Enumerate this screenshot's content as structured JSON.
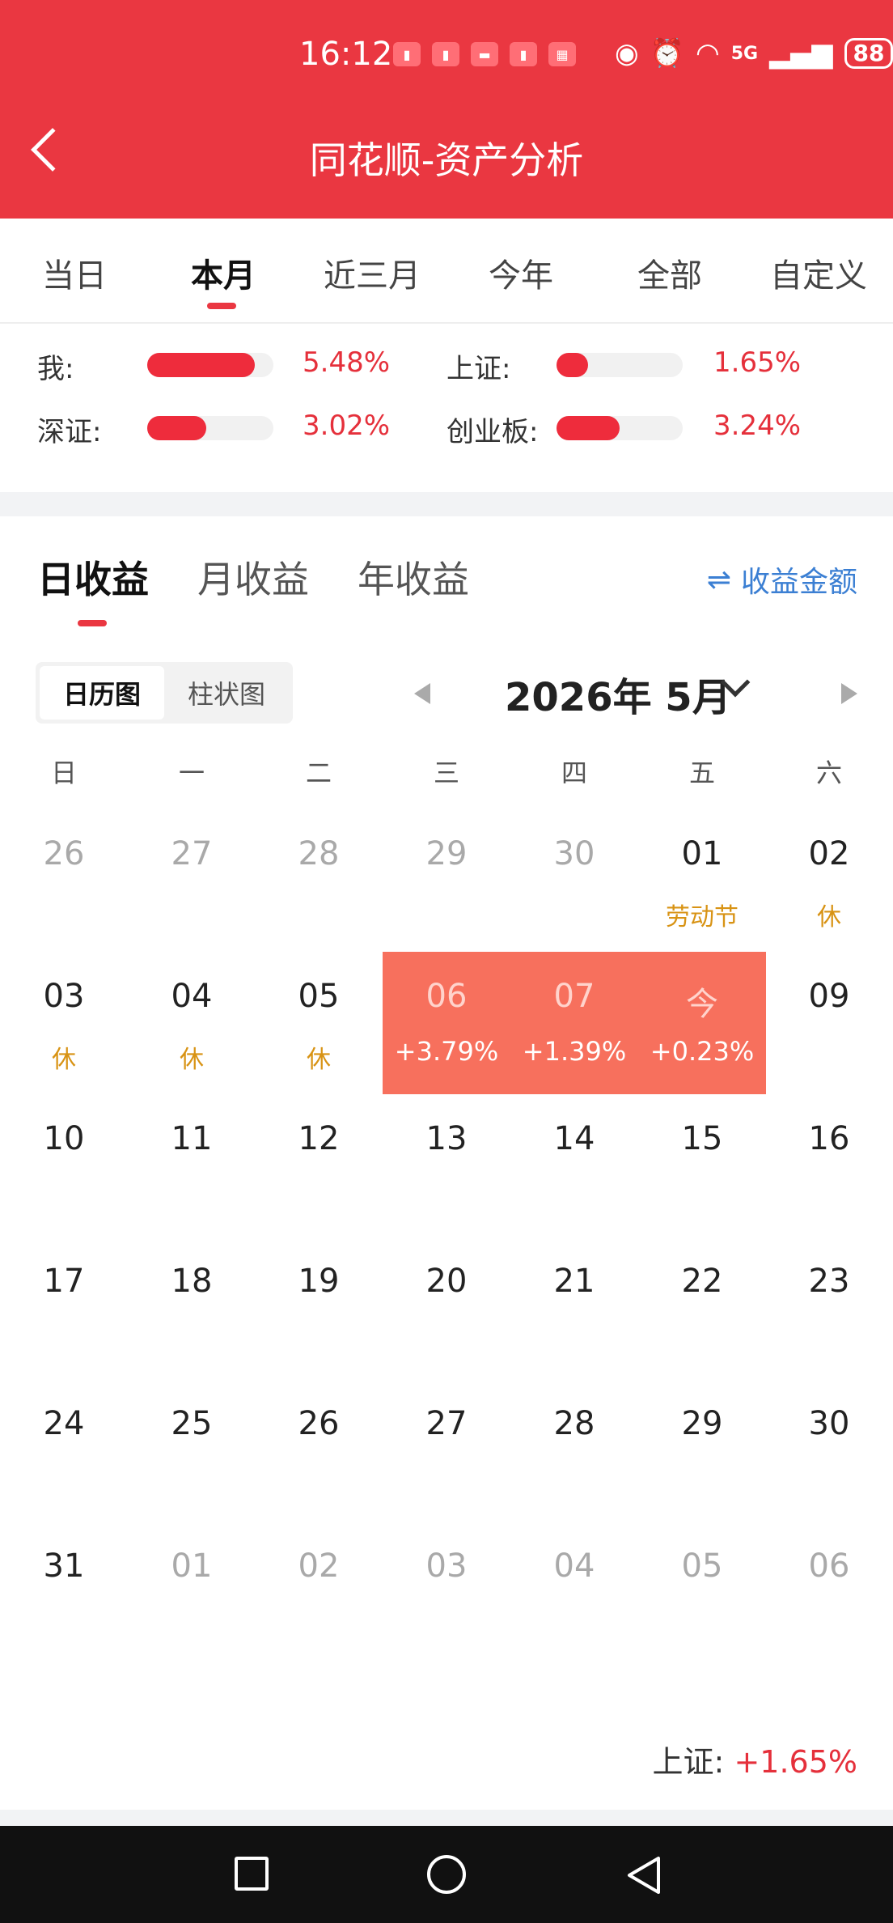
{
  "status_bar": {
    "time": "16:12",
    "notifications": [
      "app-notification-icon",
      "app-notification-icon",
      "huawei-store-icon",
      "app-notification-icon",
      "app-notification-icon"
    ],
    "network": "5G",
    "battery": "88"
  },
  "header": {
    "title": "同花顺-资产分析"
  },
  "period_tabs": [
    {
      "label": "当日"
    },
    {
      "label": "本月",
      "active": true
    },
    {
      "label": "近三月"
    },
    {
      "label": "今年"
    },
    {
      "label": "全部"
    },
    {
      "label": "自定义"
    }
  ],
  "comparison": [
    {
      "label": "我:",
      "value": "5.48%",
      "fill": 0.85
    },
    {
      "label": "上证:",
      "value": "1.65%",
      "fill": 0.25
    },
    {
      "label": "深证:",
      "value": "3.02%",
      "fill": 0.47
    },
    {
      "label": "创业板:",
      "value": "3.24%",
      "fill": 0.5
    }
  ],
  "earnings_tabs": [
    {
      "label": "日收益",
      "active": true
    },
    {
      "label": "月收益"
    },
    {
      "label": "年收益"
    }
  ],
  "amount_toggle": {
    "icon": "swap-icon",
    "label": "收益金额"
  },
  "view_switch": [
    {
      "label": "日历图",
      "active": true
    },
    {
      "label": "柱状图"
    }
  ],
  "month_nav": {
    "label": "2026年 5月"
  },
  "weekdays": [
    "日",
    "一",
    "二",
    "三",
    "四",
    "五",
    "六"
  ],
  "calendar": [
    [
      {
        "d": "26",
        "dim": true
      },
      {
        "d": "27",
        "dim": true
      },
      {
        "d": "28",
        "dim": true
      },
      {
        "d": "29",
        "dim": true
      },
      {
        "d": "30",
        "dim": true
      },
      {
        "d": "01",
        "sub": "劳动节"
      },
      {
        "d": "02",
        "sub": "休"
      }
    ],
    [
      {
        "d": "03",
        "sub": "休"
      },
      {
        "d": "04",
        "sub": "休"
      },
      {
        "d": "05",
        "sub": "休"
      },
      {
        "d": "06",
        "sub": "+3.79%",
        "gain": true
      },
      {
        "d": "07",
        "sub": "+1.39%",
        "gain": true
      },
      {
        "d": "今",
        "sub": "+0.23%",
        "gain": true,
        "today": true
      },
      {
        "d": "09"
      }
    ],
    [
      {
        "d": "10"
      },
      {
        "d": "11"
      },
      {
        "d": "12"
      },
      {
        "d": "13"
      },
      {
        "d": "14"
      },
      {
        "d": "15"
      },
      {
        "d": "16"
      }
    ],
    [
      {
        "d": "17"
      },
      {
        "d": "18"
      },
      {
        "d": "19"
      },
      {
        "d": "20"
      },
      {
        "d": "21"
      },
      {
        "d": "22"
      },
      {
        "d": "23"
      }
    ],
    [
      {
        "d": "24"
      },
      {
        "d": "25"
      },
      {
        "d": "26"
      },
      {
        "d": "27"
      },
      {
        "d": "28"
      },
      {
        "d": "29"
      },
      {
        "d": "30"
      }
    ],
    [
      {
        "d": "31"
      },
      {
        "d": "01",
        "dim": true
      },
      {
        "d": "02",
        "dim": true
      },
      {
        "d": "03",
        "dim": true
      },
      {
        "d": "04",
        "dim": true
      },
      {
        "d": "05",
        "dim": true
      },
      {
        "d": "06",
        "dim": true
      }
    ]
  ],
  "index_footer": {
    "label": "上证:",
    "value": "+1.65%"
  },
  "colors": {
    "brand": "#ea3741",
    "gain_cell": "#f7705d",
    "link": "#3b7fd3",
    "holiday": "#d89314"
  }
}
